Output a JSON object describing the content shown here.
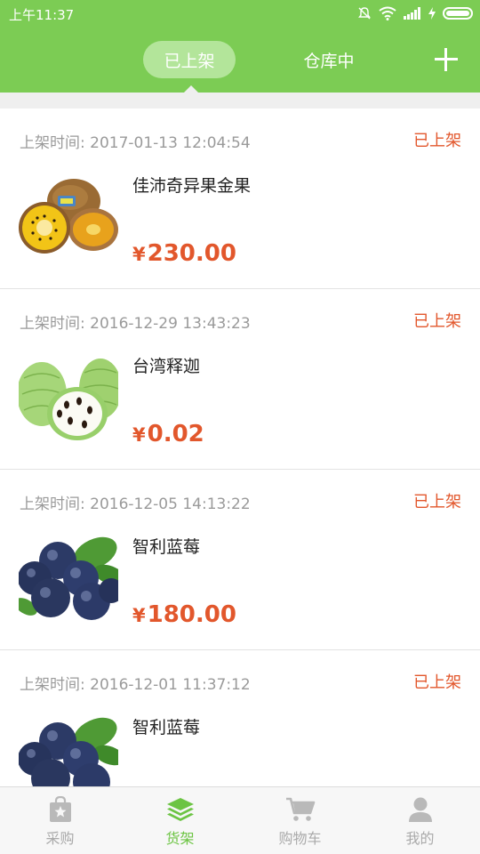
{
  "status": {
    "time": "上午11:37"
  },
  "header": {
    "tabs": [
      {
        "label": "已上架",
        "active": true
      },
      {
        "label": "仓库中",
        "active": false
      }
    ]
  },
  "products": [
    {
      "time_label": "上架时间:",
      "time": "2017-01-13 12:04:54",
      "status": "已上架",
      "name": "佳沛奇异果金果",
      "currency": "¥",
      "price": "230.00",
      "image": "kiwi-image"
    },
    {
      "time_label": "上架时间:",
      "time": "2016-12-29 13:43:23",
      "status": "已上架",
      "name": "台湾释迦",
      "currency": "¥",
      "price": "0.02",
      "image": "sugar-apple-image"
    },
    {
      "time_label": "上架时间:",
      "time": "2016-12-05 14:13:22",
      "status": "已上架",
      "name": "智利蓝莓",
      "currency": "¥",
      "price": "180.00",
      "image": "blueberry-image"
    },
    {
      "time_label": "上架时间:",
      "time": "2016-12-01 11:37:12",
      "status": "已上架",
      "name": "智利蓝莓",
      "currency": "¥",
      "price": "",
      "image": "blueberry-image"
    }
  ],
  "nav": {
    "items": [
      {
        "label": "采购",
        "icon": "purchase-bag-icon",
        "active": false
      },
      {
        "label": "货架",
        "icon": "shelf-layers-icon",
        "active": true
      },
      {
        "label": "购物车",
        "icon": "cart-icon",
        "active": false
      },
      {
        "label": "我的",
        "icon": "user-icon",
        "active": false
      }
    ]
  },
  "colors": {
    "brand": "#7ccc54",
    "price": "#e2572c",
    "active_nav": "#6cc443"
  }
}
